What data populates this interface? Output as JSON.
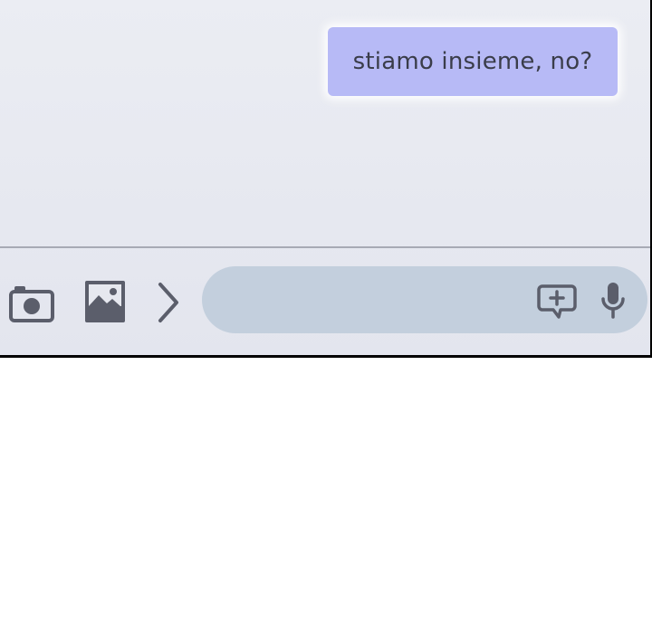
{
  "conversation": {
    "messages": [
      {
        "sender": "me",
        "text": "stiamo insieme, no?"
      }
    ]
  },
  "composer": {
    "input_value": "",
    "input_placeholder": "",
    "icons": {
      "camera": "camera-icon",
      "gallery": "image-icon",
      "expand": "chevron-right-icon",
      "sticker": "add-sticker-icon",
      "mic": "microphone-icon"
    }
  },
  "colors": {
    "panel_background": "#e6e8ef",
    "outgoing_bubble": "#b7baf6",
    "input_pill": "#c3cfdd",
    "icon": "#5b5e6b",
    "divider": "#a7aab5"
  }
}
